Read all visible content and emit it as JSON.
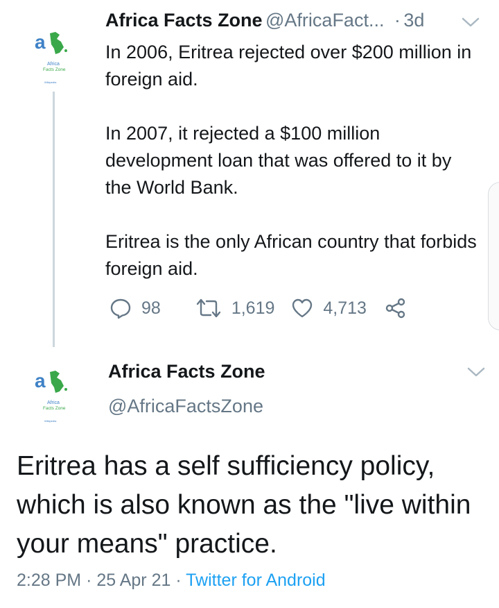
{
  "tweet1": {
    "author_name": "Africa Facts Zone",
    "author_handle": "@AfricaFact...",
    "dot": "·",
    "time_ago": "3d",
    "paragraphs": [
      "In 2006, Eritrea rejected over $200 million in foreign aid.",
      "In 2007, it rejected a $100 million development loan that was offered to it by the World Bank.",
      "Eritrea is the only African country that forbids foreign aid."
    ],
    "replies": "98",
    "retweets": "1,619",
    "likes": "4,713"
  },
  "tweet2": {
    "author_name": "Africa Facts Zone",
    "author_handle": "@AfricaFactsZone",
    "text": "Eritrea has a self sufficiency policy, which is also known as the \"live within your means\" practice.",
    "time": "2:28 PM",
    "date": "25 Apr 21",
    "source": "Twitter for Android",
    "sep": "·"
  },
  "avatar": {
    "logo_text": "Africa Facts Zone",
    "tagline": "Wikipedia"
  },
  "icons": {
    "reply": "reply-icon",
    "retweet": "retweet-icon",
    "like": "heart-icon",
    "share": "share-icon",
    "menu": "chevron-down-icon"
  },
  "colors": {
    "text": "#14171a",
    "muted": "#657786",
    "link": "#1da1f2",
    "logo_blue": "#3f82c6",
    "logo_green": "#3aa84a"
  }
}
